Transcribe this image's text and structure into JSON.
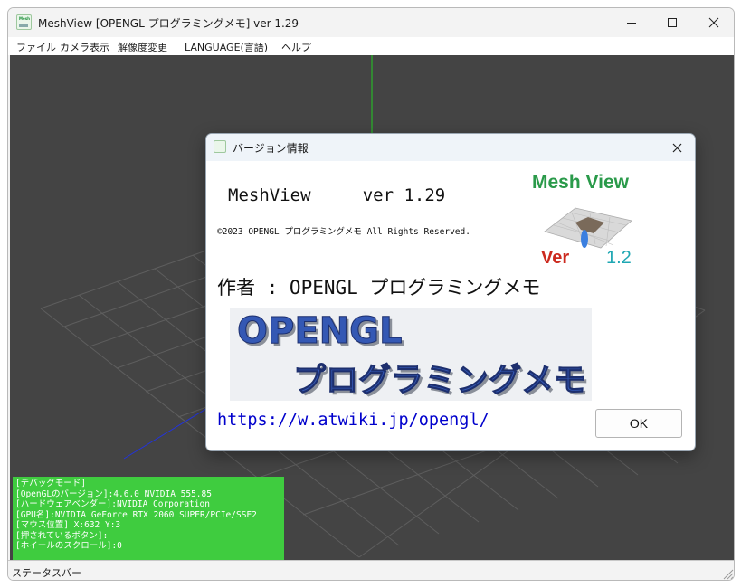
{
  "window": {
    "title": "MeshView [OPENGL プログラミングメモ] ver 1.29",
    "app_icon": "meshview-icon",
    "controls": {
      "minimize": "minimize-icon",
      "maximize": "maximize-icon",
      "close": "close-icon"
    }
  },
  "menu": {
    "items": [
      {
        "label": "ファイル"
      },
      {
        "label": "カメラ表示"
      },
      {
        "label": "解像度変更"
      },
      {
        "label": "LANGUAGE(言語)"
      },
      {
        "label": "ヘルプ"
      }
    ]
  },
  "viewport": {
    "background": "#444444",
    "grid_color": "#5e5e5e",
    "axis_y_color": "#22cc22",
    "axis_z_color": "#2233dd",
    "debug": {
      "background": "#3fcc3f",
      "lines": [
        "[デバッグモード]",
        "[OpenGLのバージョン]:4.6.0 NVIDIA 555.85",
        "[ハードウェアベンダー]:NVIDIA Corporation",
        "[GPU名]:NVIDIA GeForce RTX 2060 SUPER/PCIe/SSE2",
        "[マウス位置] X:632 Y:3",
        "[押されているボタン]:",
        "[ホイールのスクロール]:0"
      ]
    }
  },
  "statusbar": {
    "text": "ステータスバー"
  },
  "about_dialog": {
    "title": "バージョン情報",
    "app_name_line": "MeshView     ver 1.29",
    "copyright": "©2023 OPENGL プログラミングメモ All Rights Reserved.",
    "author_line": "作者 : OPENGL プログラミングメモ",
    "logo": {
      "title": "Mesh View",
      "ver_label": "Ver",
      "ver_number": "1.2"
    },
    "banner": {
      "line1": "OPENGL",
      "line2": "プログラミングメモ"
    },
    "link": "https://w.atwiki.jp/opengl/",
    "ok_label": "OK",
    "colors": {
      "link": "#0000cc",
      "logo_green": "#2a9a4a",
      "logo_red": "#cc2a1f",
      "logo_cyan": "#1fa7b3",
      "banner_text": "#3458b4"
    }
  }
}
